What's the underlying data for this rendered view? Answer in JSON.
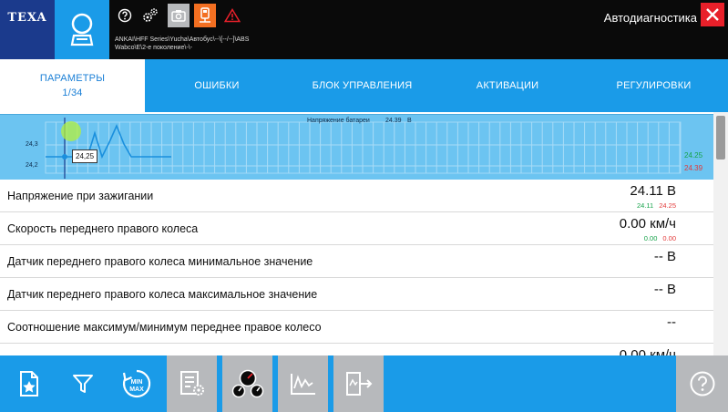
{
  "header": {
    "logo_text": "TEXA",
    "breadcrumb_line1": "ANKAI\\HFF Series\\Yucha\\Автобус\\--\\[--/--]\\ABS",
    "breadcrumb_line2": "Wabco\\E\\2-е поколение\\-\\-",
    "app_title": "Автодиагностика",
    "icons": [
      "search-icon",
      "help-icon",
      "settings-icon",
      "camera-icon",
      "device-icon",
      "warning-icon",
      "close-icon"
    ]
  },
  "tabs": [
    {
      "label": "ПАРАМЕТРЫ",
      "sub": "1/34",
      "active": true
    },
    {
      "label": "ОШИБКИ"
    },
    {
      "label": "БЛОК УПРАВЛЕНИЯ"
    },
    {
      "label": "АКТИВАЦИИ"
    },
    {
      "label": "РЕГУЛИРОВКИ"
    }
  ],
  "graph": {
    "title": "Напряжение батареи",
    "value": "24.39",
    "unit": "В",
    "y_ticks": [
      "24,3",
      "24,2"
    ],
    "legend_max": "24.25",
    "legend_min": "24.39",
    "tooltip": "24,25"
  },
  "params": [
    {
      "name": "Напряжение при зажигании",
      "value": "24.11 В",
      "min": "24.11",
      "max": "24.25"
    },
    {
      "name": "Скорость переднего правого колеса",
      "value": "0.00 км/ч",
      "min": "0.00",
      "max": "0.00"
    },
    {
      "name": "Датчик переднего правого колеса минимальное значение",
      "value": "-- В"
    },
    {
      "name": "Датчик  переднего правого колеса максимальное значение",
      "value": "-- В"
    },
    {
      "name": "Соотношение максимум/минимум переднее правое колесо",
      "value": "--"
    },
    {
      "name": "",
      "value": "0.00 км/ч"
    }
  ],
  "bottom_bar": {
    "icons": [
      "favorite-icon",
      "filter-icon",
      "minmax-icon",
      "parameter-settings-icon",
      "gauges-icon",
      "graph-icon",
      "export-icon",
      "help-icon"
    ]
  },
  "colors": {
    "accent": "#1a9be8",
    "logo": "#1b3a8c",
    "graph_bg": "#6cc4f1",
    "min_green": "#16a34a",
    "max_red": "#e23a3a",
    "close_red": "#e8202a",
    "toggle_gray": "#b7b9bc"
  }
}
